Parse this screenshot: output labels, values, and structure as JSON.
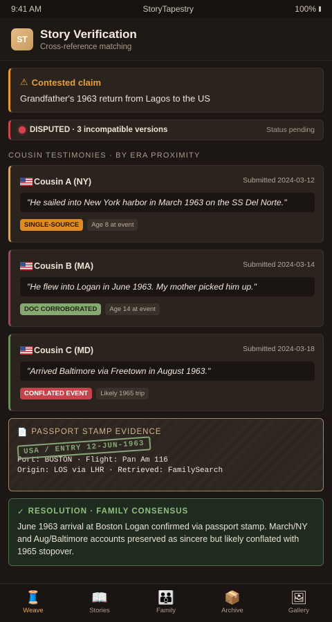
{
  "status_bar": {
    "time": "9:41 AM",
    "app": "StoryTapestry",
    "battery": "100%"
  },
  "header": {
    "logo": "ST",
    "title": "Story Verification",
    "subtitle": "Cross-reference matching"
  },
  "claim": {
    "label": "Contested claim",
    "icon": "warning-icon",
    "text": "Grandfather's 1963 return from Lagos to the US"
  },
  "dispute": {
    "status": "DISPUTED · 3 incompatible versions",
    "pending": "Status pending"
  },
  "section_title": "COUSIN TESTIMONIES · BY ERA PROXIMITY",
  "testimonies": [
    {
      "name": "Cousin A (NY)",
      "submitted": "Submitted 2024-03-12",
      "quote": "\"He sailed into New York harbor in March 1963 on the SS Del Norte.\"",
      "tag": "SINGLE-SOURCE",
      "note": "Age 8 at event"
    },
    {
      "name": "Cousin B (MA)",
      "submitted": "Submitted 2024-03-14",
      "quote": "\"He flew into Logan in June 1963. My mother picked him up.\"",
      "tag": "DOC CORROBORATED",
      "note": "Age 14 at event"
    },
    {
      "name": "Cousin C (MD)",
      "submitted": "Submitted 2024-03-18",
      "quote": "\"Arrived Baltimore via Freetown in August 1963.\"",
      "tag": "CONFLATED EVENT",
      "note": "Likely 1965 trip"
    }
  ],
  "passport": {
    "label": "PASSPORT STAMP EVIDENCE",
    "stamp": "USA / ENTRY 12-JUN-1963",
    "line1": "Port: BOSTON · Flight: Pan Am 116",
    "line2": "Origin: LOS via LHR · Retrieved: FamilySearch"
  },
  "resolution": {
    "label": "RESOLUTION · FAMILY CONSENSUS",
    "text": "June 1963 arrival at Boston Logan confirmed via passport stamp. March/NY and Aug/Baltimore accounts preserved as sincere but likely conflated with 1965 stopover."
  },
  "tabs": [
    {
      "label": "Weave",
      "icon": "spool-icon"
    },
    {
      "label": "Stories",
      "icon": "book-icon"
    },
    {
      "label": "Family",
      "icon": "family-icon"
    },
    {
      "label": "Archive",
      "icon": "package-icon"
    },
    {
      "label": "Gallery",
      "icon": "picture-icon"
    }
  ],
  "colors": {
    "accent": "#e0a865",
    "disputed": "#d6454c",
    "resolution": "#8fc07d"
  }
}
